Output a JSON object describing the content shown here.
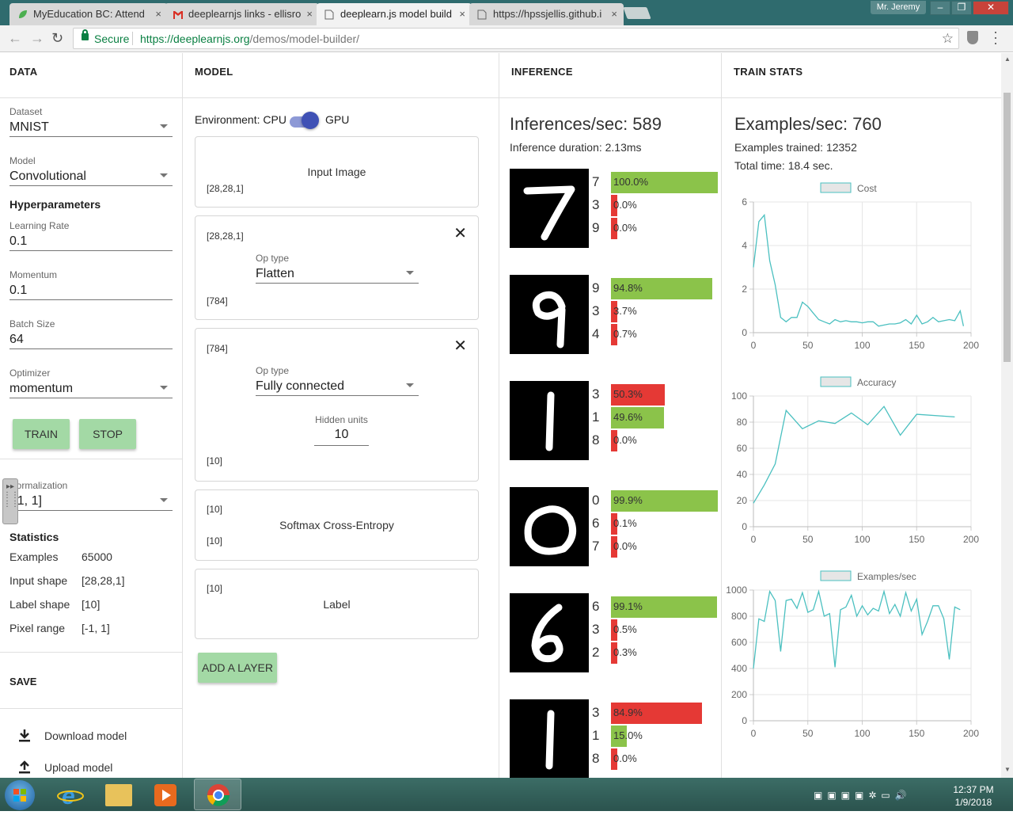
{
  "browser": {
    "tabs": [
      {
        "title": "MyEducation BC: Attend",
        "icon": "leaf-icon"
      },
      {
        "title": "deeplearnjs links - ellisro",
        "icon": "gmail-icon"
      },
      {
        "title": "deeplearn.js model build",
        "icon": "page-icon"
      },
      {
        "title": "https://hpssjellis.github.i",
        "icon": "page-icon"
      }
    ],
    "user": "Mr. Jeremy",
    "secure_label": "Secure",
    "url_host": "https://deeplearnjs.org",
    "url_path": "/demos/model-builder/"
  },
  "data_panel": {
    "header": "DATA",
    "dataset": {
      "label": "Dataset",
      "value": "MNIST"
    },
    "model": {
      "label": "Model",
      "value": "Convolutional"
    },
    "hyperparameters_title": "Hyperparameters",
    "learning_rate": {
      "label": "Learning Rate",
      "value": "0.1"
    },
    "momentum": {
      "label": "Momentum",
      "value": "0.1"
    },
    "batch_size": {
      "label": "Batch Size",
      "value": "64"
    },
    "optimizer": {
      "label": "Optimizer",
      "value": "momentum"
    },
    "train_label": "TRAIN",
    "stop_label": "STOP",
    "normalization": {
      "label": "Normalization",
      "value": "[-1, 1]"
    },
    "statistics_title": "Statistics",
    "statistics": [
      {
        "label": "Examples",
        "value": "65000"
      },
      {
        "label": "Input shape",
        "value": "[28,28,1]"
      },
      {
        "label": "Label shape",
        "value": "[10]"
      },
      {
        "label": "Pixel range",
        "value": "[-1, 1]"
      }
    ],
    "save_title": "SAVE",
    "download_label": "Download model",
    "upload_label": "Upload model"
  },
  "model_panel": {
    "header": "MODEL",
    "env_label": "Environment: CPU",
    "env_gpu": "GPU",
    "env_gpu_on": true,
    "input_layer": {
      "name": "Input Image",
      "shape": "[28,28,1]"
    },
    "flatten_layer": {
      "in_shape": "[28,28,1]",
      "op_label": "Op type",
      "op_value": "Flatten",
      "out_shape": "[784]"
    },
    "fc_layer": {
      "in_shape": "[784]",
      "op_label": "Op type",
      "op_value": "Fully connected",
      "hidden_label": "Hidden units",
      "hidden_value": "10",
      "out_shape": "[10]"
    },
    "softmax_layer": {
      "in_shape": "[10]",
      "name": "Softmax Cross-Entropy",
      "out_shape": "[10]"
    },
    "label_layer": {
      "in_shape": "[10]",
      "name": "Label"
    },
    "add_layer_label": "ADD A LAYER"
  },
  "inference_panel": {
    "header": "INFERENCE",
    "inferences_per_sec": "Inferences/sec: 589",
    "inference_duration": "Inference duration: 2.13ms",
    "colors": {
      "correct": "#8bc34a",
      "wrong": "#e53935"
    },
    "samples": [
      {
        "digit": "7",
        "preds": [
          {
            "label": "7",
            "pct": "100.0%",
            "value": 100.0,
            "correct": true
          },
          {
            "label": "3",
            "pct": "0.0%",
            "value": 0.0,
            "correct": false
          },
          {
            "label": "9",
            "pct": "0.0%",
            "value": 0.0,
            "correct": false
          }
        ]
      },
      {
        "digit": "9",
        "preds": [
          {
            "label": "9",
            "pct": "94.8%",
            "value": 94.8,
            "correct": true
          },
          {
            "label": "3",
            "pct": "3.7%",
            "value": 3.7,
            "correct": false
          },
          {
            "label": "4",
            "pct": "0.7%",
            "value": 0.7,
            "correct": false
          }
        ]
      },
      {
        "digit": "1",
        "preds": [
          {
            "label": "3",
            "pct": "50.3%",
            "value": 50.3,
            "correct": false
          },
          {
            "label": "1",
            "pct": "49.6%",
            "value": 49.6,
            "correct": true
          },
          {
            "label": "8",
            "pct": "0.0%",
            "value": 0.0,
            "correct": false
          }
        ]
      },
      {
        "digit": "0",
        "preds": [
          {
            "label": "0",
            "pct": "99.9%",
            "value": 99.9,
            "correct": true
          },
          {
            "label": "6",
            "pct": "0.1%",
            "value": 0.1,
            "correct": false
          },
          {
            "label": "7",
            "pct": "0.0%",
            "value": 0.0,
            "correct": false
          }
        ]
      },
      {
        "digit": "6",
        "preds": [
          {
            "label": "6",
            "pct": "99.1%",
            "value": 99.1,
            "correct": true
          },
          {
            "label": "3",
            "pct": "0.5%",
            "value": 0.5,
            "correct": false
          },
          {
            "label": "2",
            "pct": "0.3%",
            "value": 0.3,
            "correct": false
          }
        ]
      },
      {
        "digit": "1",
        "preds": [
          {
            "label": "3",
            "pct": "84.9%",
            "value": 84.9,
            "correct": false
          },
          {
            "label": "1",
            "pct": "15.0%",
            "value": 15.0,
            "correct": true
          },
          {
            "label": "8",
            "pct": "0.0%",
            "value": 0.0,
            "correct": false
          }
        ]
      }
    ]
  },
  "train_panel": {
    "header": "TRAIN STATS",
    "examples_per_sec": "Examples/sec: 760",
    "examples_trained": "Examples trained: 12352",
    "total_time": "Total time: 18.4 sec.",
    "line_color": "#4bc0c0"
  },
  "chart_data": [
    {
      "type": "line",
      "title": "",
      "legend": "Cost",
      "xlim": [
        0,
        200
      ],
      "xticks": [
        0,
        50,
        100,
        150,
        200
      ],
      "ylim": [
        0,
        6
      ],
      "yticks": [
        0,
        2,
        4,
        6
      ],
      "x": [
        0,
        5,
        10,
        15,
        20,
        25,
        30,
        35,
        40,
        45,
        50,
        55,
        60,
        65,
        70,
        75,
        80,
        85,
        90,
        95,
        100,
        105,
        110,
        115,
        120,
        125,
        130,
        135,
        140,
        145,
        150,
        155,
        160,
        165,
        170,
        175,
        180,
        185,
        190,
        193
      ],
      "values": [
        3.0,
        5.1,
        5.4,
        3.3,
        2.2,
        0.7,
        0.5,
        0.7,
        0.7,
        1.4,
        1.2,
        0.9,
        0.6,
        0.5,
        0.4,
        0.6,
        0.5,
        0.55,
        0.5,
        0.5,
        0.45,
        0.5,
        0.5,
        0.3,
        0.35,
        0.4,
        0.4,
        0.45,
        0.6,
        0.4,
        0.8,
        0.4,
        0.5,
        0.7,
        0.5,
        0.55,
        0.6,
        0.55,
        1.0,
        0.3
      ]
    },
    {
      "type": "line",
      "title": "",
      "legend": "Accuracy",
      "xlim": [
        0,
        200
      ],
      "xticks": [
        0,
        50,
        100,
        150,
        200
      ],
      "ylim": [
        0,
        100
      ],
      "yticks": [
        0,
        20,
        40,
        60,
        80,
        100
      ],
      "x": [
        0,
        10,
        20,
        30,
        45,
        60,
        75,
        90,
        105,
        120,
        135,
        150,
        165,
        185
      ],
      "values": [
        18,
        32,
        48,
        89,
        75,
        81,
        79,
        87,
        78,
        92,
        70,
        86,
        null,
        84
      ]
    },
    {
      "type": "line",
      "title": "",
      "legend": "Examples/sec",
      "xlim": [
        0,
        200
      ],
      "xticks": [
        0,
        50,
        100,
        150,
        200
      ],
      "ylim": [
        0,
        1000
      ],
      "yticks": [
        0,
        200,
        400,
        600,
        800,
        1000
      ],
      "x": [
        0,
        5,
        10,
        15,
        20,
        25,
        30,
        35,
        40,
        45,
        50,
        55,
        60,
        65,
        70,
        75,
        80,
        85,
        90,
        95,
        100,
        105,
        110,
        115,
        120,
        125,
        130,
        135,
        140,
        145,
        150,
        155,
        160,
        165,
        170,
        175,
        180,
        185,
        190
      ],
      "values": [
        400,
        780,
        760,
        990,
        920,
        530,
        920,
        930,
        860,
        980,
        830,
        850,
        990,
        800,
        820,
        410,
        850,
        870,
        960,
        800,
        880,
        810,
        860,
        840,
        990,
        820,
        890,
        800,
        980,
        840,
        930,
        660,
        760,
        880,
        880,
        780,
        470,
        870,
        850
      ]
    }
  ],
  "taskbar": {
    "time": "12:37 PM",
    "date": "1/9/2018"
  }
}
